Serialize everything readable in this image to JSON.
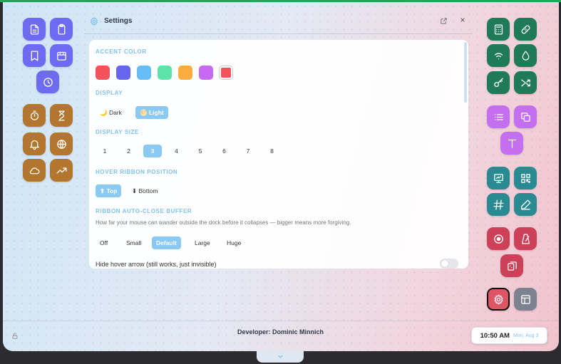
{
  "settings": {
    "title": "Settings",
    "close_label": "×",
    "accent_color_label": "ACCENT COLOR",
    "accent_colors": [
      "#f2525c",
      "#6566ec",
      "#67bdf5",
      "#5de3a9",
      "#fbab3f",
      "#c66af4",
      "#f2525c"
    ],
    "display_label": "DISPLAY",
    "display_options": [
      "🌙 Dark",
      "🌕 Light"
    ],
    "display_size_label": "DISPLAY SIZE",
    "display_sizes": [
      "1",
      "2",
      "3",
      "4",
      "5",
      "6",
      "7",
      "8"
    ],
    "hover_ribbon_label": "HOVER RIBBON POSITION",
    "ribbon_positions": [
      "⬆ Top",
      "⬇ Bottom"
    ],
    "autoclose_label": "RIBBON AUTO-CLOSE BUFFER",
    "autoclose_desc": "How far your mouse can wander outside the dock before it collapses — bigger means more forgiving.",
    "buffer_options": [
      "Off",
      "Small",
      "Default",
      "Large",
      "Huge"
    ],
    "hide_arrow_label": "Hide hover arrow (still works, just invisible)"
  },
  "footer": {
    "developer": "Developer: Dominic Minnich",
    "time": "10:50 AM",
    "date": "Mon, Aug 3"
  },
  "left_icons": [
    "document-icon",
    "clipboard-icon",
    "bookmark-icon",
    "calendar-icon",
    "clock-icon",
    "stopwatch-icon",
    "hourglass-icon",
    "bell-icon",
    "globe-icon",
    "cloud-icon",
    "trending-up-icon"
  ],
  "right_icons": [
    "calculator-icon",
    "bandage-icon",
    "wifi-icon",
    "droplet-icon",
    "key-icon",
    "shuffle-icon",
    "list-icon",
    "copy-icon",
    "text-icon",
    "presentation-icon",
    "qr-grid-icon",
    "hash-icon",
    "pen-icon",
    "record-icon",
    "metronome-icon",
    "dice-cards-icon",
    "settings-gear-icon",
    "layout-icon"
  ],
  "colors": {
    "accent": "#89c9f3",
    "purple": "#6e6af2",
    "brown": "#b3762f",
    "green": "#1f7a5a",
    "violet": "#c46ff0",
    "teal": "#2a8a92",
    "red": "#cc4158"
  }
}
